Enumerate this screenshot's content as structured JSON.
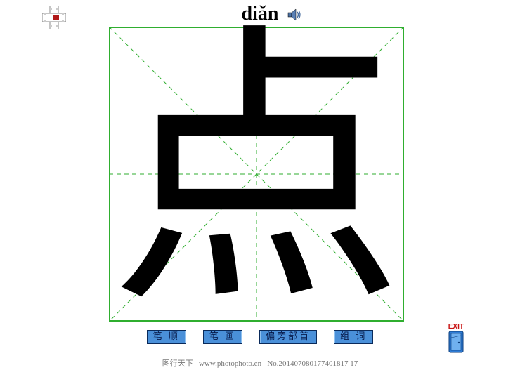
{
  "pinyin": "diǎn",
  "character": "点",
  "buttons": {
    "stroke_order": "笔 顺",
    "strokes": "笔 画",
    "radical": "偏旁部首",
    "words": "组 词"
  },
  "exit_label": "EXIT",
  "footer": {
    "site_name": "图行天下",
    "url": "www.photophoto.cn",
    "serial": "No.201407080177401817 17"
  },
  "colors": {
    "grid_border": "#2fae2f",
    "grid_dash": "#2fae2f",
    "button_bg": "#4a90d9",
    "button_border": "#0a2a5a",
    "exit_red": "#c81414",
    "door_blue": "#2f7dd6"
  },
  "icons": {
    "speaker": "speaker-icon",
    "cross": "plus-cross-icon",
    "exit_door": "door-icon"
  }
}
